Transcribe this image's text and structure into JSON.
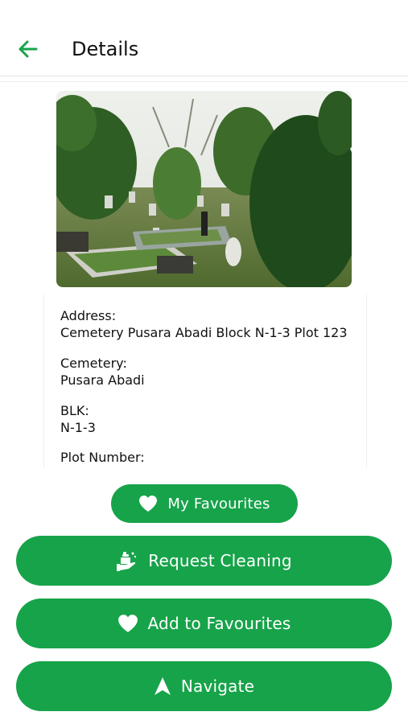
{
  "header": {
    "title": "Details"
  },
  "details": {
    "address_label": "Address:",
    "address_value": "Cemetery Pusara Abadi Block N-1-3 Plot 123",
    "cemetery_label": "Cemetery:",
    "cemetery_value": "Pusara Abadi",
    "blk_label": "BLK:",
    "blk_value": "N-1-3",
    "plot_label": "Plot Number:"
  },
  "buttons": {
    "my_favourites": "My Favourites",
    "request_cleaning": "Request Cleaning",
    "add_to_favourites": "Add to Favourites",
    "navigate": "Navigate"
  },
  "colors": {
    "accent": "#17a34a"
  },
  "icons": {
    "back": "arrow-left-icon",
    "favourites": "heart-icon",
    "cleaning": "cleaning-hand-icon",
    "navigate": "navigation-arrow-icon"
  }
}
